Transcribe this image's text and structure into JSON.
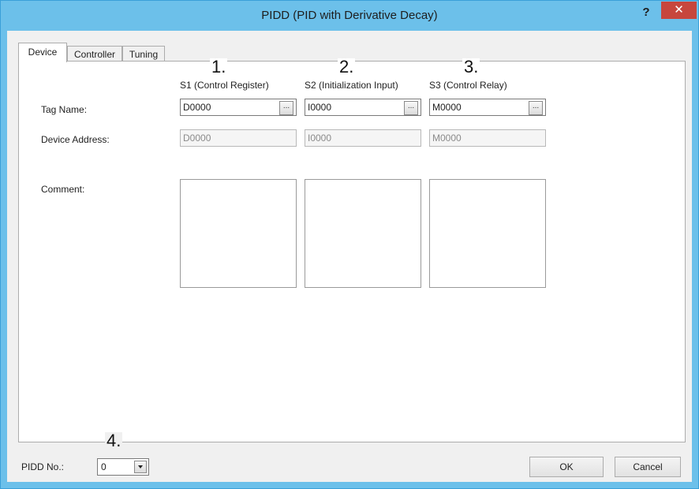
{
  "window": {
    "title": "PIDD (PID with Derivative Decay)",
    "help_label": "?",
    "close_label": "✕"
  },
  "tabs": [
    {
      "label": "Device"
    },
    {
      "label": "Controller"
    },
    {
      "label": "Tuning"
    }
  ],
  "device": {
    "tag_name_label": "Tag Name:",
    "device_address_label": "Device Address:",
    "comment_label": "Comment:",
    "columns": [
      {
        "marker": "1.",
        "header": "S1 (Control Register)",
        "tag_value": "D0000",
        "address_value": "D0000"
      },
      {
        "marker": "2.",
        "header": "S2 (Initialization Input)",
        "tag_value": "I0000",
        "address_value": "I0000"
      },
      {
        "marker": "3.",
        "header": "S3 (Control Relay)",
        "tag_value": "M0000",
        "address_value": "M0000"
      }
    ],
    "browse_label": "..."
  },
  "footer": {
    "marker": "4.",
    "pidd_no_label": "PIDD No.:",
    "pidd_no_value": "0",
    "ok_label": "OK",
    "cancel_label": "Cancel"
  }
}
